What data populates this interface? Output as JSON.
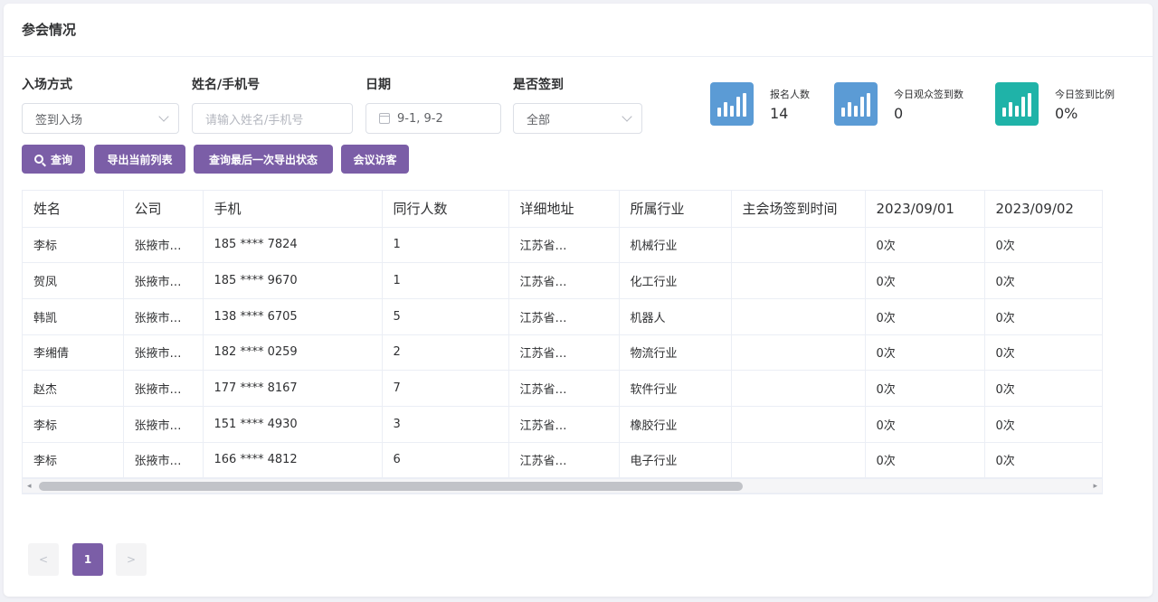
{
  "title": "参会情况",
  "filters": {
    "entry_method": {
      "label": "入场方式",
      "value": "签到入场"
    },
    "name_phone": {
      "label": "姓名/手机号",
      "placeholder": "请输入姓名/手机号"
    },
    "date": {
      "label": "日期",
      "value": "9-1, 9-2"
    },
    "checked_in": {
      "label": "是否签到",
      "value": "全部"
    }
  },
  "buttons": {
    "query": "查询",
    "export_list": "导出当前列表",
    "query_last_export": "查询最后一次导出状态",
    "visitors": "会议访客"
  },
  "stats": [
    {
      "label": "报名人数",
      "value": "14",
      "color": "#5b9bd5"
    },
    {
      "label": "今日观众签到数",
      "value": "0",
      "color": "#5b9bd5"
    },
    {
      "label": "今日签到比例",
      "value": "0%",
      "color": "#1fb3a8"
    }
  ],
  "table": {
    "columns": [
      "姓名",
      "公司",
      "手机",
      "同行人数",
      "详细地址",
      "所属行业",
      "主会场签到时间",
      "2023/09/01",
      "2023/09/02"
    ],
    "rows": [
      [
        "李标",
        "张掖市…",
        "185 **** 7824",
        "1",
        "江苏省…",
        "机械行业",
        "",
        "0次",
        "0次"
      ],
      [
        "贺凤",
        "张掖市…",
        "185 **** 9670",
        "1",
        "江苏省…",
        "化工行业",
        "",
        "0次",
        "0次"
      ],
      [
        "韩凯",
        "张掖市…",
        "138 **** 6705",
        "5",
        "江苏省…",
        "机器人",
        "",
        "0次",
        "0次"
      ],
      [
        "李缃倩",
        "张掖市…",
        "182 **** 0259",
        "2",
        "江苏省…",
        "物流行业",
        "",
        "0次",
        "0次"
      ],
      [
        "赵杰",
        "张掖市…",
        "177 **** 8167",
        "7",
        "江苏省…",
        "软件行业",
        "",
        "0次",
        "0次"
      ],
      [
        "李标",
        "张掖市…",
        "151 **** 4930",
        "3",
        "江苏省…",
        "橡胶行业",
        "",
        "0次",
        "0次"
      ],
      [
        "李标",
        "张掖市…",
        "166 **** 4812",
        "6",
        "江苏省…",
        "电子行业",
        "",
        "0次",
        "0次"
      ]
    ]
  },
  "pagination": {
    "prev": "<",
    "current": "1",
    "next": ">"
  },
  "colors": {
    "accent": "#7b5ea7"
  }
}
